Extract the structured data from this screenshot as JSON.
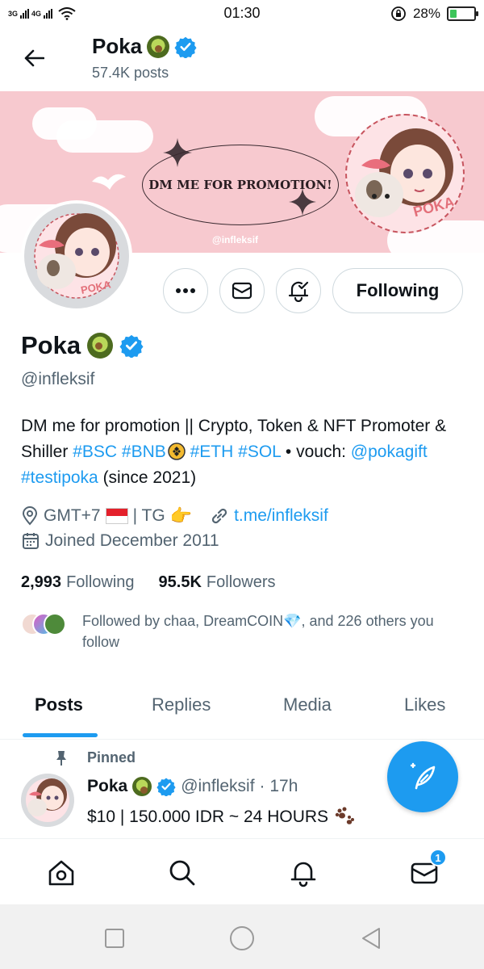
{
  "status_bar": {
    "network1": "3G",
    "network2": "4G",
    "time": "01:30",
    "battery": "28%",
    "battery_level": 0.28
  },
  "header": {
    "name": "Poka",
    "posts": "57.4K posts"
  },
  "banner": {
    "promo_text": "DM ME FOR PROMOTION!",
    "handle": "@infleksif",
    "logo_text": "POKA"
  },
  "actions": {
    "follow_label": "Following"
  },
  "profile": {
    "name": "Poka",
    "handle": "@infleksif",
    "bio_part1": "DM me for promotion || Crypto, Token & NFT Promoter & Shiller ",
    "tag_bsc": "#BSC",
    "tag_bnb": "#BNB",
    "tag_eth": "#ETH",
    "tag_sol": "#SOL",
    "bio_part2": " • vouch: ",
    "mention": "@pokagift",
    "tag_testi": "#testipoka",
    "bio_part3": " (since 2021)",
    "location": "GMT+7",
    "location_suffix": "| TG",
    "link": "t.me/infleksif",
    "joined": "Joined December 2011"
  },
  "counts": {
    "following_value": "2,993",
    "following_label": "Following",
    "followers_value": "95.5K",
    "followers_label": "Followers"
  },
  "followed_by": "Followed by chaa, DreamCOIN💎, and 226 others you follow",
  "tabs": [
    "Posts",
    "Replies",
    "Media",
    "Likes"
  ],
  "pinned_tweet": {
    "pinned_label": "Pinned",
    "name": "Poka",
    "handle": "@infleksif",
    "time": "· 17h",
    "text": "$10 | 150.000 IDR ~ 24 HOURS"
  },
  "bottom_nav": {
    "messages_badge": "1"
  },
  "colors": {
    "accent": "#1d9bf0",
    "banner": "#f7c9cf",
    "text_primary": "#0f1419",
    "text_secondary": "#536471"
  }
}
